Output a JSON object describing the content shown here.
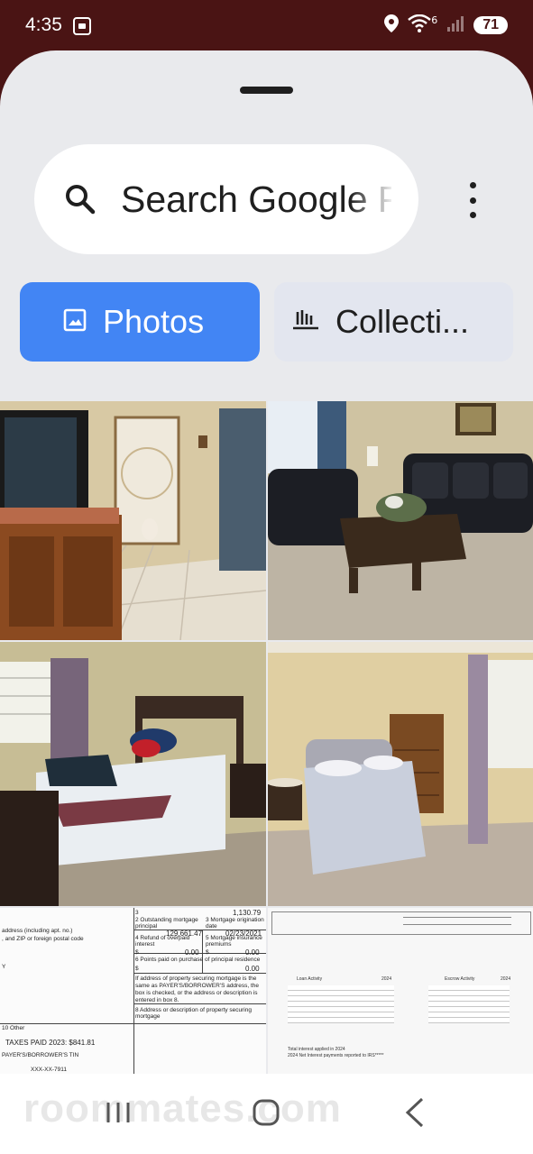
{
  "status": {
    "time": "4:35",
    "signal_label": "6",
    "battery": "71"
  },
  "search": {
    "placeholder": "Search Google P"
  },
  "tabs": [
    {
      "label": "Photos",
      "icon": "image-icon"
    },
    {
      "label": "Collecti...",
      "icon": "collections-icon"
    }
  ],
  "photos": [
    {
      "name": "living-room-door-tv"
    },
    {
      "name": "living-room-leather-sofa"
    },
    {
      "name": "bedroom-with-window"
    },
    {
      "name": "bedroom-with-dresser"
    },
    {
      "name": "mortgage-form-1098"
    },
    {
      "name": "escrow-statement"
    }
  ],
  "doc1": {
    "line1": "address (including apt. no.)",
    "line2": ", and ZIP or foreign postal code",
    "box3": "3",
    "amount_top": "1,130.79",
    "box2": "2 Outstanding mortgage principal",
    "principal": "129,661.47",
    "box3b": "3 Mortgage origination date",
    "orig_date": "02/23/2021",
    "box4": "4 Refund of overpaid interest",
    "box5": "5 Mortgage insurance premiums",
    "dollar": "$",
    "zero": "0.00",
    "box6": "6 Points paid on purchase of principal residence",
    "box7": "If address of property securing mortgage is the same as PAYER'S/BORROWER'S address, the box is checked, or the address or description is entered in box 8.",
    "box8": "8 Address or description of property securing mortgage",
    "box10": "10 Other",
    "taxes": "TAXES PAID 2023: $841.81",
    "tin": "PAYER'S/BORROWER'S TIN",
    "tin_value": "XXX-XX-7911",
    "y": "Y"
  },
  "doc2": {
    "col_left": "Loan Activity",
    "col_right": "Escrow Activity",
    "year": "2024",
    "footer1": "Total interest applied in 2024",
    "footer2": "2024 Net Interest payments reported to IRS*****"
  },
  "nav": {
    "watermark": "roommates.com"
  },
  "colors": {
    "accent": "#4285f4",
    "statusbar": "#4a1414",
    "sheet": "#e9eaed"
  }
}
